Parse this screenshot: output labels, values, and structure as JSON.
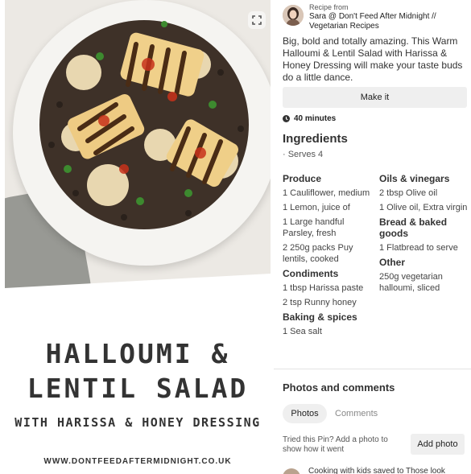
{
  "pin_image": {
    "title_line1": "HALLOUMI &",
    "title_line2": "LENTIL SALAD",
    "title_line3": "WITH HARISSA & HONEY DRESSING",
    "website": "WWW.DONTFEEDAFTERMIDNIGHT.CO.UK"
  },
  "author": {
    "recipe_from": "Recipe from",
    "name": "Sara @ Don't Feed After Midnight // Vegetarian Recipes"
  },
  "description": "Big, bold and totally amazing. This Warm Halloumi & Lentil Salad with Harissa & Honey Dressing will make your taste buds do a little dance.",
  "make_it_label": "Make it",
  "time": "40 minutes",
  "ingredients": {
    "title": "Ingredients",
    "serves": "· Serves 4",
    "col_a": {
      "produce": {
        "title": "Produce",
        "items": [
          "1 Cauliflower, medium",
          "1 Lemon, juice of",
          "1 Large handful Parsley, fresh",
          "2 250g packs Puy lentils, cooked"
        ]
      },
      "condiments": {
        "title": "Condiments",
        "items": [
          "1 tbsp Harissa paste",
          "2 tsp Runny honey"
        ]
      },
      "baking": {
        "title": "Baking & spices",
        "items": [
          "1 Sea salt"
        ]
      }
    },
    "col_b": {
      "oils": {
        "title": "Oils & vinegars",
        "items": [
          "2 tbsp Olive oil",
          "1 Olive oil, Extra virgin"
        ]
      },
      "bread": {
        "title": "Bread & baked goods",
        "items": [
          "1 Flatbread to serve"
        ]
      },
      "other": {
        "title": "Other",
        "items": [
          "250g vegetarian halloumi, sliced"
        ]
      }
    }
  },
  "photos_comments": {
    "title": "Photos and comments",
    "tab_photos": "Photos",
    "tab_comments": "Comments",
    "tried_text": "Tried this Pin? Add a photo to show how it went",
    "add_photo_label": "Add photo",
    "bottom_text": "Cooking with kids saved to Those look"
  },
  "icons": {
    "expand": "expand-icon",
    "clock": "clock-icon",
    "avatar": "avatar"
  }
}
